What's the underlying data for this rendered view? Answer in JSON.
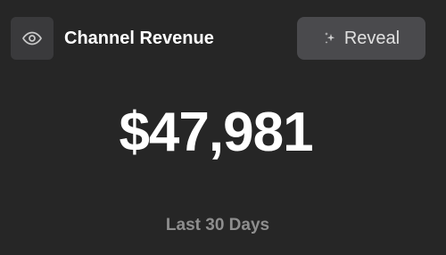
{
  "header": {
    "icon": "eye-icon",
    "title": "Channel Revenue"
  },
  "reveal_button": {
    "icon": "sparkle-icon",
    "label": "Reveal"
  },
  "metric": {
    "value": "$47,981",
    "period": "Last 30 Days"
  },
  "colors": {
    "background": "#262626",
    "icon_box": "#3a3a3c",
    "button": "#4a4a4d",
    "muted_text": "#8e8e8e"
  }
}
